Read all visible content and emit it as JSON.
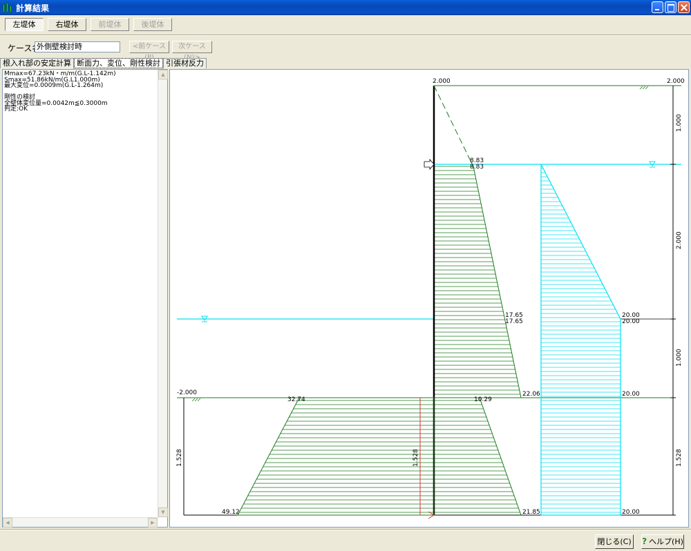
{
  "window": {
    "title": "計算結果"
  },
  "toolbar": {
    "buttons": [
      "左堤体",
      "右堤体",
      "前堤体",
      "後堤体"
    ]
  },
  "case": {
    "label": "ケース名",
    "value": "外側壁検討時",
    "prev": "<前ケース(P)",
    "next": "次ケース(N)>"
  },
  "tabs": [
    "根入れ部の安定計算",
    "断面力、変位、剛性検討",
    "引張材反力"
  ],
  "results": [
    "Mmax=67.23kN・m/m(G.L-1.142m)",
    "Smax=51.86kN/m(G.L1.000m)",
    "最大変位=0.0009m(G.L-1.264m)",
    "",
    "剛性の検討",
    "全壁体変位量=0.0042m≦0.3000m",
    "判定:OK"
  ],
  "footer": {
    "close": "閉じる(C)",
    "help": "ヘルプ(H)"
  },
  "colors": {
    "green": "#1b7a1b",
    "cyan": "#00e0f0",
    "red": "#e03030"
  },
  "chart_data": {
    "type": "diagram",
    "levels": [
      "2.000",
      "2.000",
      "-2.000"
    ],
    "dims": [
      "1.000",
      "2.000",
      "1.000",
      "1.528",
      "1.528",
      "1.528"
    ],
    "green_labels": [
      "8.83",
      "8.83",
      "17.65",
      "17.65",
      "22.06",
      "32.74",
      "10.29",
      "49.12",
      "21.85"
    ],
    "cyan_labels": [
      "20.00",
      "20.00",
      "20.00",
      "20.00"
    ]
  }
}
